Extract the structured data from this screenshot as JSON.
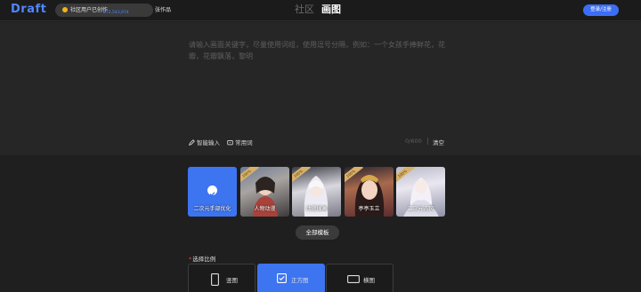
{
  "header": {
    "logo": "Draft",
    "notice": "社区用户已创作",
    "count": "272,543,974",
    "notice_suffix": "张作品",
    "tabs": [
      "社区",
      "画图"
    ],
    "active_tab": "画图",
    "login_label": "登录/注册"
  },
  "prompt": {
    "placeholder": "请输入画面关键字，尽量使用词组，使用逗号分隔，例如：一个女孩手捧鲜花，花瓣，花瓣飘落，黎明",
    "tool_smart": "智能输入",
    "tool_common": "常用词",
    "counter": "0/600",
    "clear_label": "清空"
  },
  "templates": {
    "items": [
      {
        "label": "二次元手部优化",
        "selected": true,
        "badge": ""
      },
      {
        "label": "人物动漫",
        "selected": false,
        "badge": "100%"
      },
      {
        "label": "动漫插画",
        "selected": false,
        "badge": "100%"
      },
      {
        "label": "亭亭玉立",
        "selected": false,
        "badge": "100%"
      },
      {
        "label": "二次元古风",
        "selected": false,
        "badge": "100%"
      }
    ],
    "all_button": "全部模板"
  },
  "ratio": {
    "title": "选择比例",
    "options": [
      {
        "label": "竖图",
        "selected": false
      },
      {
        "label": "正方图",
        "selected": true
      },
      {
        "label": "横图",
        "selected": false
      }
    ]
  },
  "colors": {
    "accent": "#3d74f0",
    "background": "#1f1f1f",
    "badge": "#d7b06a"
  }
}
